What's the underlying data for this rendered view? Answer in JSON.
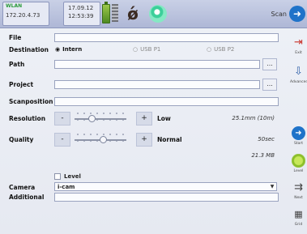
{
  "status_bar": {
    "network_status": "WLAN",
    "ip": "172.20.4.73",
    "date": "17.09.12",
    "time": "12:53:39",
    "scan_label": "Scan"
  },
  "form": {
    "file": {
      "label": "File",
      "value": ""
    },
    "destination": {
      "label": "Destination",
      "options": [
        {
          "label": "Intern",
          "selected": true
        },
        {
          "label": "USB P1",
          "selected": false
        },
        {
          "label": "USB P2",
          "selected": false
        }
      ]
    },
    "path": {
      "label": "Path",
      "value": "",
      "browse": "..."
    },
    "project": {
      "label": "Project",
      "value": "",
      "browse": "..."
    },
    "scanposition": {
      "label": "Scanposition",
      "value": ""
    },
    "resolution": {
      "label": "Resolution",
      "minus": "-",
      "plus": "+",
      "level": "Low",
      "detail": "25.1mm (10m)",
      "slider_fraction": 0.33
    },
    "quality": {
      "label": "Quality",
      "minus": "-",
      "plus": "+",
      "level": "Normal",
      "detail": "50sec",
      "slider_fraction": 0.55
    },
    "file_size": "21.3 MB",
    "level_option": {
      "label": "Level",
      "checked": false
    },
    "camera": {
      "label": "Camera",
      "value": "i-cam"
    },
    "additional": {
      "label": "Additional",
      "value": ""
    }
  },
  "sidebar": [
    {
      "icon": "exit-icon",
      "label": "Exit"
    },
    {
      "icon": "advanced-icon",
      "label": "Advanced"
    },
    {
      "icon": "start-icon",
      "label": "Start"
    },
    {
      "icon": "level-icon",
      "label": "Level"
    },
    {
      "icon": "next-icon",
      "label": "Next"
    },
    {
      "icon": "grid-icon",
      "label": "Grid"
    }
  ],
  "colors": {
    "accent": "#1f73c9",
    "status_green": "#2a9a3a",
    "background": "#e9ecf3"
  }
}
